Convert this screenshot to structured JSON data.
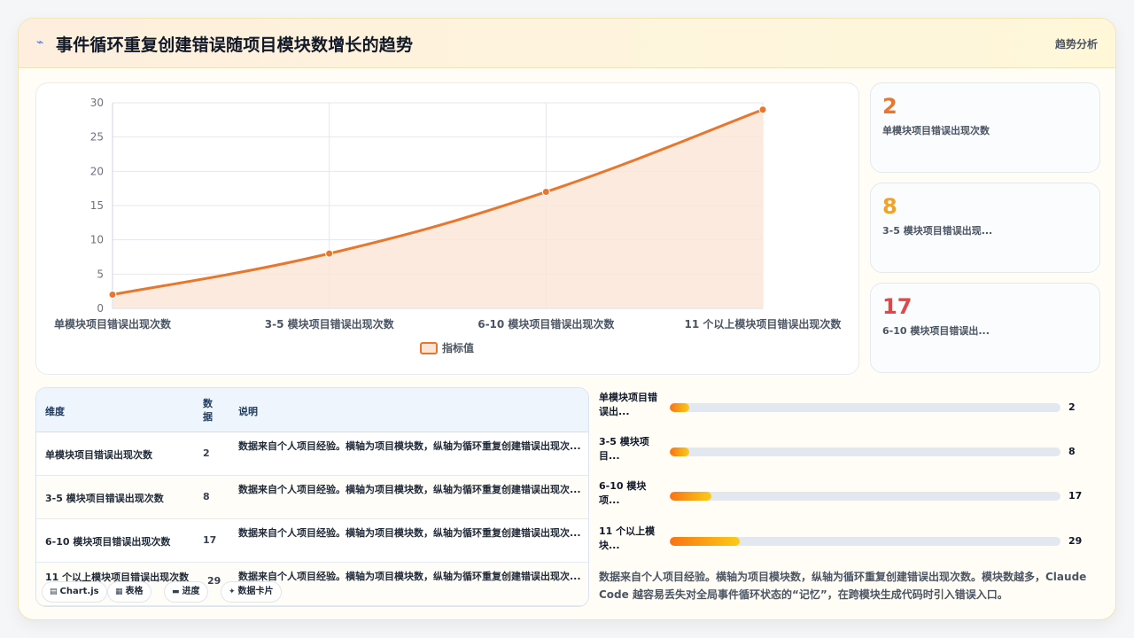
{
  "header": {
    "icon": "lightning-icon",
    "title": "事件循环重复创建错误随项目模块数增长的趋势",
    "tag": "趋势分析"
  },
  "colors": {
    "accent": "#e8762c",
    "fill": "#fde5d6",
    "stat1": "#e8762c",
    "stat2": "#f0a32a",
    "stat3": "#e04848"
  },
  "chart_data": {
    "type": "line",
    "categories": [
      "单模块项目错误出现次数",
      "3-5 模块项目错误出现次数",
      "6-10 模块项目错误出现次数",
      "11 个以上模块项目错误出现次数"
    ],
    "series": [
      {
        "name": "指标值",
        "values": [
          2,
          8,
          17,
          29
        ]
      }
    ],
    "ylim": [
      0,
      30
    ],
    "yticks": [
      0,
      5,
      10,
      15,
      20,
      25,
      30
    ],
    "grid": true,
    "legend": "bottom",
    "area_fill": true
  },
  "stats": [
    {
      "value": "2",
      "label": "单模块项目错误出现次数"
    },
    {
      "value": "8",
      "label": "3-5 模块项目错误出现..."
    },
    {
      "value": "17",
      "label": "6-10 模块项目错误出..."
    }
  ],
  "table": {
    "headers": [
      "维度",
      "数据",
      "说明"
    ],
    "rows": [
      {
        "dim": "单模块项目错误出现次数",
        "val": "2",
        "desc": "数据来自个人项目经验。横轴为项目模块数，纵轴为循环重复创建错误出现次..."
      },
      {
        "dim": "3-5 模块项目错误出现次数",
        "val": "8",
        "desc": "数据来自个人项目经验。横轴为项目模块数，纵轴为循环重复创建错误出现次..."
      },
      {
        "dim": "6-10 模块项目错误出现次数",
        "val": "17",
        "desc": "数据来自个人项目经验。横轴为项目模块数，纵轴为循环重复创建错误出现次..."
      },
      {
        "dim": "11 个以上模块项目错误出现次数",
        "val": "29",
        "desc": "数据来自个人项目经验。横轴为项目模块数，纵轴为循环重复创建错误出现次..."
      }
    ]
  },
  "chips": [
    {
      "icon": "chart-icon",
      "glyph": "▤",
      "label": "Chart.js"
    },
    {
      "icon": "table-icon",
      "glyph": "▦",
      "label": "表格"
    },
    {
      "icon": "progress-icon",
      "glyph": "▬",
      "label": "进度"
    },
    {
      "icon": "sparkle-icon",
      "glyph": "✦",
      "label": "数据卡片"
    }
  ],
  "progress": {
    "max": 29,
    "items": [
      {
        "label": "单模块项目错误出...",
        "value": 2,
        "text": "2"
      },
      {
        "label": "3-5 模块项目...",
        "value": 8,
        "text": "8"
      },
      {
        "label": "6-10 模块项...",
        "value": 17,
        "text": "17"
      },
      {
        "label": "11 个以上模块...",
        "value": 29,
        "text": "29"
      }
    ]
  },
  "note": "数据来自个人项目经验。横轴为项目模块数，纵轴为循环重复创建错误出现次数。模块数越多，Claude Code 越容易丢失对全局事件循环状态的“记忆”，在跨模块生成代码时引入错误入口。"
}
